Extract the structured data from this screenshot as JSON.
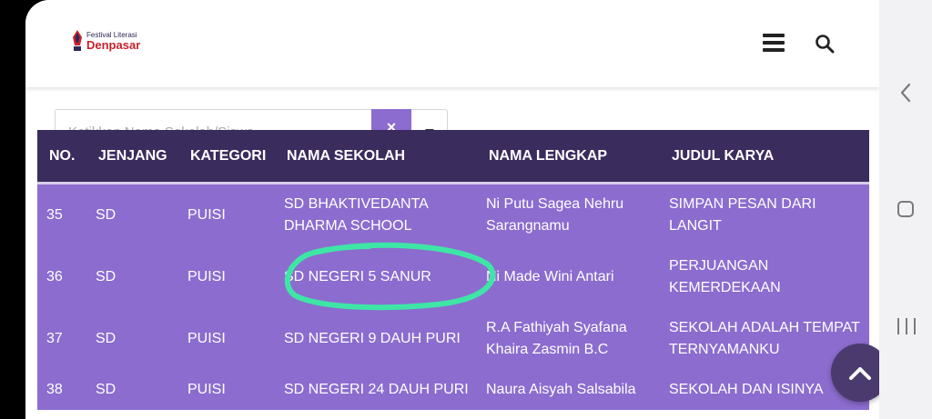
{
  "header": {
    "logo_small": "Festival Literasi",
    "logo_big": "Denpasar",
    "menu_icon": "hamburger-menu-icon",
    "search_icon": "search-icon"
  },
  "search": {
    "placeholder": "Ketikkan Nama Sekolah/Siswa",
    "clear_label": "×"
  },
  "table": {
    "headers": [
      "NO.",
      "JENJANG",
      "KATEGORI",
      "NAMA SEKOLAH",
      "NAMA LENGKAP",
      "JUDUL KARYA"
    ],
    "rows": [
      {
        "no": "35",
        "jenjang": "SD",
        "kategori": "PUISI",
        "sekolah": "SD BHAKTIVEDANTA DHARMA SCHOOL",
        "nama": "Ni Putu Sagea Nehru Sarangnamu",
        "judul": "SIMPAN PESAN DARI LANGIT"
      },
      {
        "no": "36",
        "jenjang": "SD",
        "kategori": "PUISI",
        "sekolah": "SD NEGERI 5 SANUR",
        "nama": "Ni Made Wini Antari",
        "judul": "PERJUANGAN KEMERDEKAAN"
      },
      {
        "no": "37",
        "jenjang": "SD",
        "kategori": "PUISI",
        "sekolah": "SD NEGERI 9 DAUH PURI",
        "nama": "R.A Fathiyah Syafana Khaira Zasmin B.C",
        "judul": "SEKOLAH ADALAH TEMPAT TERNYAMANKU"
      },
      {
        "no": "38",
        "jenjang": "SD",
        "kategori": "PUISI",
        "sekolah": "SD NEGERI 24 DAUH PURI",
        "nama": "Naura Aisyah Salsabila",
        "judul": "SEKOLAH DAN ISINYA"
      }
    ]
  },
  "colors": {
    "header_row": "#3b2c5e",
    "body_row": "#8c6ccf",
    "highlight": "#3ee6a6",
    "brand_red": "#c8222c"
  },
  "fab_icon": "chevron-up-icon",
  "system_nav": {
    "back_icon": "back-chevron-icon",
    "home_icon": "home-square-icon",
    "recent_icon": "recent-apps-icon"
  }
}
